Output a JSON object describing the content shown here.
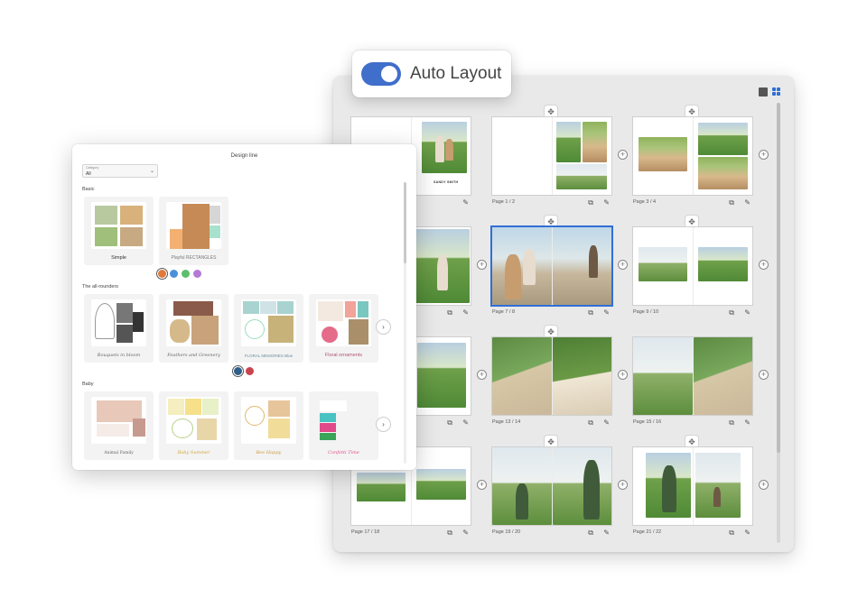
{
  "auto_layout": {
    "label": "Auto Layout",
    "enabled": true
  },
  "design_line": {
    "title": "Design line",
    "category": {
      "caption": "Category",
      "value": "All"
    },
    "sections": [
      {
        "title": "Basic",
        "cards": [
          "Simple",
          "Playful RECTANGLES"
        ],
        "colors": [
          "#e07a3a",
          "#4a90d9",
          "#5cbf6e",
          "#b37ad6"
        ],
        "selected_color": 0
      },
      {
        "title": "The all-rounders",
        "cards": [
          "Bouquets in bloom",
          "Feathers and Greenery",
          "FLORAL MEMORIES Blue",
          "Floral ornaments"
        ],
        "colors": [
          "#2e5f8a",
          "#c9434e"
        ],
        "selected_color": 0
      },
      {
        "title": "Baby",
        "cards": [
          "Animal Family",
          "Baby Summer",
          "Bee Happy",
          "Confetti Time"
        ]
      }
    ]
  },
  "spreads": [
    {
      "label": "",
      "cover_title": "SANDY SMITH"
    },
    {
      "label": "Page 1 / 2"
    },
    {
      "label": "Page 3 / 4"
    },
    {
      "label": ""
    },
    {
      "label": "Page 7 / 8",
      "selected": true
    },
    {
      "label": "Page 9 / 10"
    },
    {
      "label": ""
    },
    {
      "label": "Page 13 / 14"
    },
    {
      "label": "Page 15 / 16"
    },
    {
      "label": "Page 17 / 18"
    },
    {
      "label": "Page 19 / 20"
    },
    {
      "label": "Page 21 / 22"
    }
  ],
  "icons": {
    "move": "move-icon",
    "add": "add-page-icon",
    "duplicate": "duplicate-icon",
    "edit": "pencil-icon",
    "next": "chevron-right-icon"
  }
}
